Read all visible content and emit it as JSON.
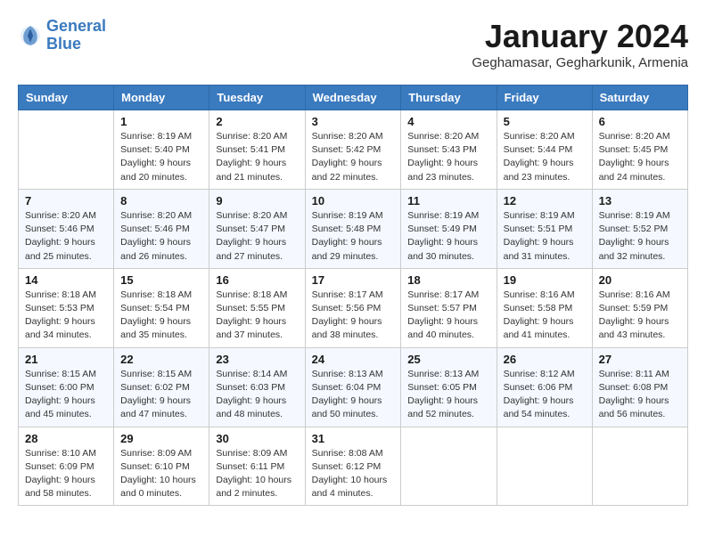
{
  "logo": {
    "line1": "General",
    "line2": "Blue"
  },
  "title": "January 2024",
  "location": "Geghamasar, Gegharkunik, Armenia",
  "days_header": [
    "Sunday",
    "Monday",
    "Tuesday",
    "Wednesday",
    "Thursday",
    "Friday",
    "Saturday"
  ],
  "weeks": [
    [
      {
        "day": "",
        "sunrise": "",
        "sunset": "",
        "daylight": ""
      },
      {
        "day": "1",
        "sunrise": "Sunrise: 8:19 AM",
        "sunset": "Sunset: 5:40 PM",
        "daylight": "Daylight: 9 hours and 20 minutes."
      },
      {
        "day": "2",
        "sunrise": "Sunrise: 8:20 AM",
        "sunset": "Sunset: 5:41 PM",
        "daylight": "Daylight: 9 hours and 21 minutes."
      },
      {
        "day": "3",
        "sunrise": "Sunrise: 8:20 AM",
        "sunset": "Sunset: 5:42 PM",
        "daylight": "Daylight: 9 hours and 22 minutes."
      },
      {
        "day": "4",
        "sunrise": "Sunrise: 8:20 AM",
        "sunset": "Sunset: 5:43 PM",
        "daylight": "Daylight: 9 hours and 23 minutes."
      },
      {
        "day": "5",
        "sunrise": "Sunrise: 8:20 AM",
        "sunset": "Sunset: 5:44 PM",
        "daylight": "Daylight: 9 hours and 23 minutes."
      },
      {
        "day": "6",
        "sunrise": "Sunrise: 8:20 AM",
        "sunset": "Sunset: 5:45 PM",
        "daylight": "Daylight: 9 hours and 24 minutes."
      }
    ],
    [
      {
        "day": "7",
        "sunrise": "Sunrise: 8:20 AM",
        "sunset": "Sunset: 5:46 PM",
        "daylight": "Daylight: 9 hours and 25 minutes."
      },
      {
        "day": "8",
        "sunrise": "Sunrise: 8:20 AM",
        "sunset": "Sunset: 5:46 PM",
        "daylight": "Daylight: 9 hours and 26 minutes."
      },
      {
        "day": "9",
        "sunrise": "Sunrise: 8:20 AM",
        "sunset": "Sunset: 5:47 PM",
        "daylight": "Daylight: 9 hours and 27 minutes."
      },
      {
        "day": "10",
        "sunrise": "Sunrise: 8:19 AM",
        "sunset": "Sunset: 5:48 PM",
        "daylight": "Daylight: 9 hours and 29 minutes."
      },
      {
        "day": "11",
        "sunrise": "Sunrise: 8:19 AM",
        "sunset": "Sunset: 5:49 PM",
        "daylight": "Daylight: 9 hours and 30 minutes."
      },
      {
        "day": "12",
        "sunrise": "Sunrise: 8:19 AM",
        "sunset": "Sunset: 5:51 PM",
        "daylight": "Daylight: 9 hours and 31 minutes."
      },
      {
        "day": "13",
        "sunrise": "Sunrise: 8:19 AM",
        "sunset": "Sunset: 5:52 PM",
        "daylight": "Daylight: 9 hours and 32 minutes."
      }
    ],
    [
      {
        "day": "14",
        "sunrise": "Sunrise: 8:18 AM",
        "sunset": "Sunset: 5:53 PM",
        "daylight": "Daylight: 9 hours and 34 minutes."
      },
      {
        "day": "15",
        "sunrise": "Sunrise: 8:18 AM",
        "sunset": "Sunset: 5:54 PM",
        "daylight": "Daylight: 9 hours and 35 minutes."
      },
      {
        "day": "16",
        "sunrise": "Sunrise: 8:18 AM",
        "sunset": "Sunset: 5:55 PM",
        "daylight": "Daylight: 9 hours and 37 minutes."
      },
      {
        "day": "17",
        "sunrise": "Sunrise: 8:17 AM",
        "sunset": "Sunset: 5:56 PM",
        "daylight": "Daylight: 9 hours and 38 minutes."
      },
      {
        "day": "18",
        "sunrise": "Sunrise: 8:17 AM",
        "sunset": "Sunset: 5:57 PM",
        "daylight": "Daylight: 9 hours and 40 minutes."
      },
      {
        "day": "19",
        "sunrise": "Sunrise: 8:16 AM",
        "sunset": "Sunset: 5:58 PM",
        "daylight": "Daylight: 9 hours and 41 minutes."
      },
      {
        "day": "20",
        "sunrise": "Sunrise: 8:16 AM",
        "sunset": "Sunset: 5:59 PM",
        "daylight": "Daylight: 9 hours and 43 minutes."
      }
    ],
    [
      {
        "day": "21",
        "sunrise": "Sunrise: 8:15 AM",
        "sunset": "Sunset: 6:00 PM",
        "daylight": "Daylight: 9 hours and 45 minutes."
      },
      {
        "day": "22",
        "sunrise": "Sunrise: 8:15 AM",
        "sunset": "Sunset: 6:02 PM",
        "daylight": "Daylight: 9 hours and 47 minutes."
      },
      {
        "day": "23",
        "sunrise": "Sunrise: 8:14 AM",
        "sunset": "Sunset: 6:03 PM",
        "daylight": "Daylight: 9 hours and 48 minutes."
      },
      {
        "day": "24",
        "sunrise": "Sunrise: 8:13 AM",
        "sunset": "Sunset: 6:04 PM",
        "daylight": "Daylight: 9 hours and 50 minutes."
      },
      {
        "day": "25",
        "sunrise": "Sunrise: 8:13 AM",
        "sunset": "Sunset: 6:05 PM",
        "daylight": "Daylight: 9 hours and 52 minutes."
      },
      {
        "day": "26",
        "sunrise": "Sunrise: 8:12 AM",
        "sunset": "Sunset: 6:06 PM",
        "daylight": "Daylight: 9 hours and 54 minutes."
      },
      {
        "day": "27",
        "sunrise": "Sunrise: 8:11 AM",
        "sunset": "Sunset: 6:08 PM",
        "daylight": "Daylight: 9 hours and 56 minutes."
      }
    ],
    [
      {
        "day": "28",
        "sunrise": "Sunrise: 8:10 AM",
        "sunset": "Sunset: 6:09 PM",
        "daylight": "Daylight: 9 hours and 58 minutes."
      },
      {
        "day": "29",
        "sunrise": "Sunrise: 8:09 AM",
        "sunset": "Sunset: 6:10 PM",
        "daylight": "Daylight: 10 hours and 0 minutes."
      },
      {
        "day": "30",
        "sunrise": "Sunrise: 8:09 AM",
        "sunset": "Sunset: 6:11 PM",
        "daylight": "Daylight: 10 hours and 2 minutes."
      },
      {
        "day": "31",
        "sunrise": "Sunrise: 8:08 AM",
        "sunset": "Sunset: 6:12 PM",
        "daylight": "Daylight: 10 hours and 4 minutes."
      },
      {
        "day": "",
        "sunrise": "",
        "sunset": "",
        "daylight": ""
      },
      {
        "day": "",
        "sunrise": "",
        "sunset": "",
        "daylight": ""
      },
      {
        "day": "",
        "sunrise": "",
        "sunset": "",
        "daylight": ""
      }
    ]
  ]
}
